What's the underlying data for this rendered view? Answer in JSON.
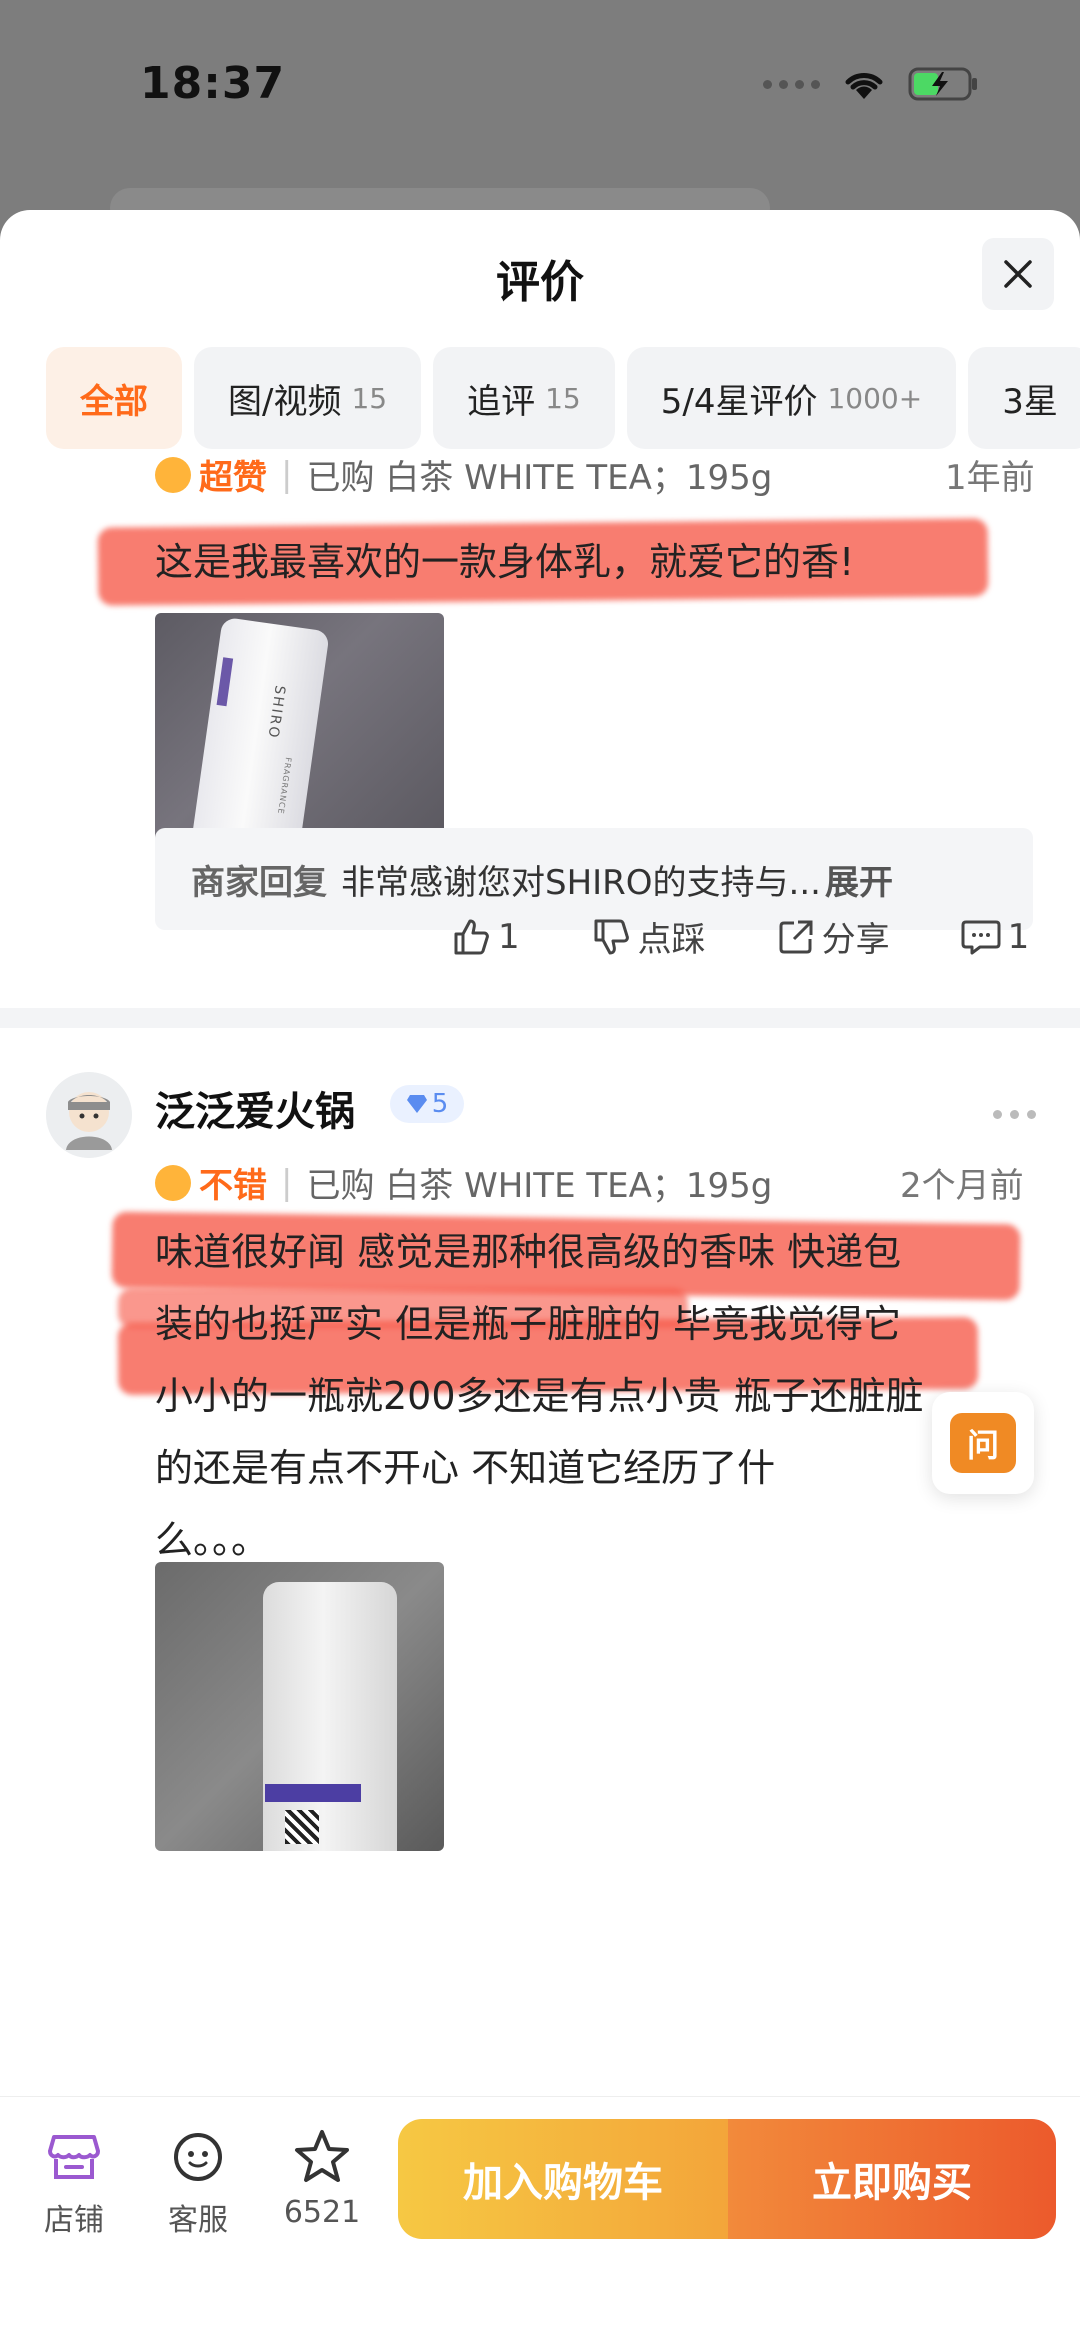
{
  "status_bar": {
    "time": "18:37"
  },
  "sheet": {
    "title": "评价"
  },
  "tabs": [
    {
      "label": "全部",
      "count": ""
    },
    {
      "label": "图/视频",
      "count": "15"
    },
    {
      "label": "追评",
      "count": "15"
    },
    {
      "label": "5/4星评价",
      "count": "1000+"
    },
    {
      "label": "3星",
      "count": ""
    }
  ],
  "review1": {
    "rating_text": "超赞",
    "purchased": "已购 白茶 WHITE TEA；195g",
    "time": "1年前",
    "text": "这是我最喜欢的一款身体乳，就爱它的香!",
    "photo_brand": "SHIRO",
    "photo_sub": "FRAGRANCE",
    "merchant_reply": {
      "label": "商家回复",
      "text": "非常感谢您对SHIRO的支持与...",
      "expand": "展开"
    },
    "actions": {
      "like": "1",
      "dislike": "点踩",
      "share": "分享",
      "comment": "1"
    }
  },
  "review2": {
    "username": "泛泛爱火锅",
    "level": "5",
    "rating_text": "不错",
    "purchased": "已购 白茶 WHITE TEA；195g",
    "time": "2个月前",
    "text_lines": [
      "味道很好闻 感觉是那种很高级的香味 快递包",
      "装的也挺严实 但是瓶子脏脏的 毕竟我觉得它",
      "小小的一瓶就200多还是有点小贵 瓶子还脏脏",
      "的还是有点不开心 不知道它经历了什",
      "么。。。"
    ]
  },
  "ask_button": {
    "label": "问"
  },
  "bottom_bar": {
    "shop": "店铺",
    "service": "客服",
    "favorites": "6521",
    "add_to_cart": "加入购物车",
    "buy_now": "立即购买"
  },
  "colors": {
    "accent": "#ff6a1a",
    "cart": "#f6c843",
    "buy": "#ec5a2c",
    "highlight": "#f65848"
  }
}
